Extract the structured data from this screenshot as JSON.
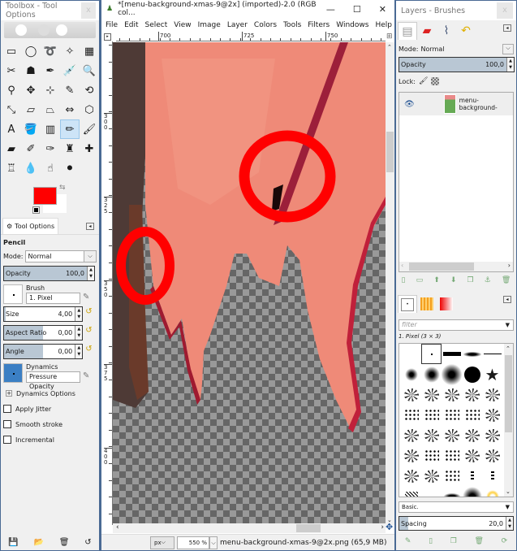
{
  "toolbox": {
    "title": "Toolbox - Tool Options",
    "close": "x",
    "tools": [
      {
        "name": "rect-select-icon",
        "glyph": "▭"
      },
      {
        "name": "ellipse-select-icon",
        "glyph": "◯"
      },
      {
        "name": "free-select-icon",
        "glyph": "➰"
      },
      {
        "name": "fuzzy-select-icon",
        "glyph": "✧"
      },
      {
        "name": "color-select-icon",
        "glyph": "▦"
      },
      {
        "name": "scissors-icon",
        "glyph": "✂"
      },
      {
        "name": "foreground-select-icon",
        "glyph": "☗"
      },
      {
        "name": "paths-icon",
        "glyph": "✒"
      },
      {
        "name": "color-picker-icon",
        "glyph": "💉"
      },
      {
        "name": "zoom-icon",
        "glyph": "🔍"
      },
      {
        "name": "measure-icon",
        "glyph": "⚲"
      },
      {
        "name": "move-icon",
        "glyph": "✥"
      },
      {
        "name": "align-icon",
        "glyph": "⊹"
      },
      {
        "name": "crop-icon",
        "glyph": "✎"
      },
      {
        "name": "rotate-icon",
        "glyph": "⟲"
      },
      {
        "name": "scale-icon",
        "glyph": "⤡"
      },
      {
        "name": "shear-icon",
        "glyph": "▱"
      },
      {
        "name": "perspective-icon",
        "glyph": "⏢"
      },
      {
        "name": "flip-icon",
        "glyph": "⇔"
      },
      {
        "name": "cage-icon",
        "glyph": "⬡"
      },
      {
        "name": "text-icon",
        "glyph": "A"
      },
      {
        "name": "bucket-fill-icon",
        "glyph": "🪣"
      },
      {
        "name": "blend-icon",
        "glyph": "▥"
      },
      {
        "name": "pencil-icon",
        "glyph": "✏"
      },
      {
        "name": "paintbrush-icon",
        "glyph": "🖌"
      },
      {
        "name": "eraser-icon",
        "glyph": "▰"
      },
      {
        "name": "airbrush-icon",
        "glyph": "✐"
      },
      {
        "name": "ink-icon",
        "glyph": "✑"
      },
      {
        "name": "clone-icon",
        "glyph": "♜"
      },
      {
        "name": "heal-icon",
        "glyph": "✚"
      },
      {
        "name": "perspective-clone-icon",
        "glyph": "♖"
      },
      {
        "name": "blur-icon",
        "glyph": "💧"
      },
      {
        "name": "smudge-icon",
        "glyph": "☝"
      },
      {
        "name": "dodge-burn-icon",
        "glyph": "⚫"
      }
    ],
    "active_tool_index": 23,
    "fg_color": "#ff0000",
    "bg_color": "#ffffff",
    "tool_options_tab": "Tool Options",
    "tool_name": "Pencil",
    "mode_label": "Mode:",
    "mode_value": "Normal",
    "opacity": {
      "label": "Opacity",
      "value": "100,0",
      "fraction": 1.0
    },
    "brush": {
      "label": "Brush",
      "value": "1. Pixel"
    },
    "size": {
      "label": "Size",
      "value": "4,00",
      "fraction": 0.02
    },
    "aspect_ratio": {
      "label": "Aspect Ratio",
      "value": "0,00",
      "fraction": 0.5
    },
    "angle": {
      "label": "Angle",
      "value": "0,00",
      "fraction": 0.5
    },
    "dynamics": {
      "label": "Dynamics",
      "value": "Pressure Opacity"
    },
    "dynamics_options": "Dynamics Options",
    "checkboxes": [
      {
        "label": "Apply Jitter",
        "checked": false
      },
      {
        "label": "Smooth stroke",
        "checked": false
      },
      {
        "label": "Incremental",
        "checked": false
      }
    ],
    "footer_icons": [
      "save-options-icon",
      "restore-options-icon",
      "delete-options-icon",
      "reset-options-icon"
    ]
  },
  "image_window": {
    "title": "*[menu-background-xmas-9@2x] (imported)-2.0 (RGB col...",
    "controls": {
      "minimize": "—",
      "maximize": "☐",
      "close": "✕"
    },
    "menu": [
      "File",
      "Edit",
      "Select",
      "View",
      "Image",
      "Layer",
      "Colors",
      "Tools",
      "Filters",
      "Windows",
      "Help"
    ],
    "ruler_top": [
      "700",
      "725",
      "750"
    ],
    "ruler_left": [
      "300",
      "325",
      "350",
      "375",
      "400"
    ],
    "unit": "px",
    "zoom": "550 %",
    "status": "menu-background-xmas-9@2x.png (65,9 MB)"
  },
  "dock": {
    "title": "Layers - Brushes",
    "close": "x",
    "tabs": [
      "layers-tab",
      "channels-tab",
      "paths-tab",
      "undo-history-tab"
    ],
    "mode_label": "Mode:",
    "mode_value": "Normal",
    "opacity": {
      "label": "Opacity",
      "value": "100,0",
      "fraction": 1.0
    },
    "lock_label": "Lock:",
    "layers": [
      {
        "name": "menu-background-",
        "visible": true
      }
    ],
    "layer_buttons": [
      "new-layer-icon",
      "new-layer-group-icon",
      "raise-layer-icon",
      "lower-layer-icon",
      "duplicate-layer-icon",
      "anchor-layer-icon",
      "delete-layer-icon"
    ],
    "filter_placeholder": "filter",
    "brush_name": "1. Pixel (3 × 3)",
    "brush_set": "Basic.",
    "spacing": {
      "label": "Spacing",
      "value": "20,0",
      "fraction": 0.08
    },
    "brush_buttons": [
      "edit-brush-icon",
      "new-brush-icon",
      "duplicate-brush-icon",
      "delete-brush-icon",
      "refresh-brushes-icon"
    ]
  }
}
